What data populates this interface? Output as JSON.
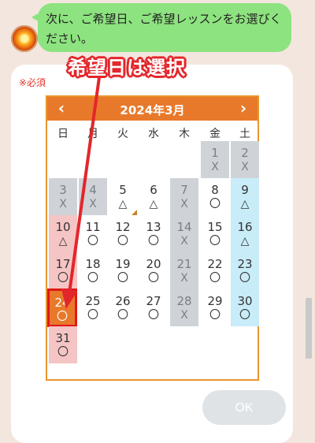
{
  "chat": {
    "message": "次に、ご希望日、ご希望レッスンをお選びください。",
    "required_label": "※必須"
  },
  "annotation": {
    "callout": "希望日は選択",
    "color": "#e3262b"
  },
  "calendar": {
    "title": "2024年3月",
    "prev_icon": "‹",
    "next_icon": "›",
    "weekdays": [
      "日",
      "月",
      "火",
      "水",
      "木",
      "金",
      "土"
    ],
    "weeks": [
      [
        null,
        null,
        null,
        null,
        null,
        {
          "day": "1",
          "mark": "X",
          "state": "closed"
        },
        {
          "day": "2",
          "mark": "X",
          "state": "closed"
        }
      ],
      [
        {
          "day": "3",
          "mark": "X",
          "state": "closed"
        },
        {
          "day": "4",
          "mark": "X",
          "state": "closed"
        },
        {
          "day": "5",
          "mark": "△",
          "state": "open",
          "corner": true
        },
        {
          "day": "6",
          "mark": "△",
          "state": "open"
        },
        {
          "day": "7",
          "mark": "X",
          "state": "closed"
        },
        {
          "day": "8",
          "mark": "〇",
          "state": "open"
        },
        {
          "day": "9",
          "mark": "△",
          "state": "sat"
        }
      ],
      [
        {
          "day": "10",
          "mark": "△",
          "state": "sun"
        },
        {
          "day": "11",
          "mark": "〇",
          "state": "open"
        },
        {
          "day": "12",
          "mark": "〇",
          "state": "open"
        },
        {
          "day": "13",
          "mark": "〇",
          "state": "open"
        },
        {
          "day": "14",
          "mark": "X",
          "state": "closed"
        },
        {
          "day": "15",
          "mark": "〇",
          "state": "open"
        },
        {
          "day": "16",
          "mark": "△",
          "state": "sat"
        }
      ],
      [
        {
          "day": "17",
          "mark": "〇",
          "state": "sun"
        },
        {
          "day": "18",
          "mark": "〇",
          "state": "open"
        },
        {
          "day": "19",
          "mark": "〇",
          "state": "open"
        },
        {
          "day": "20",
          "mark": "〇",
          "state": "open"
        },
        {
          "day": "21",
          "mark": "X",
          "state": "closed"
        },
        {
          "day": "22",
          "mark": "〇",
          "state": "open"
        },
        {
          "day": "23",
          "mark": "〇",
          "state": "sat"
        }
      ],
      [
        {
          "day": "24",
          "mark": "〇",
          "state": "selected"
        },
        {
          "day": "25",
          "mark": "〇",
          "state": "open"
        },
        {
          "day": "26",
          "mark": "〇",
          "state": "open"
        },
        {
          "day": "27",
          "mark": "〇",
          "state": "open"
        },
        {
          "day": "28",
          "mark": "X",
          "state": "closed"
        },
        {
          "day": "29",
          "mark": "〇",
          "state": "open"
        },
        {
          "day": "30",
          "mark": "〇",
          "state": "sat"
        }
      ],
      [
        {
          "day": "31",
          "mark": "〇",
          "state": "sun"
        },
        null,
        null,
        null,
        null,
        null,
        null
      ]
    ]
  },
  "ok_button": {
    "label": "OK"
  }
}
